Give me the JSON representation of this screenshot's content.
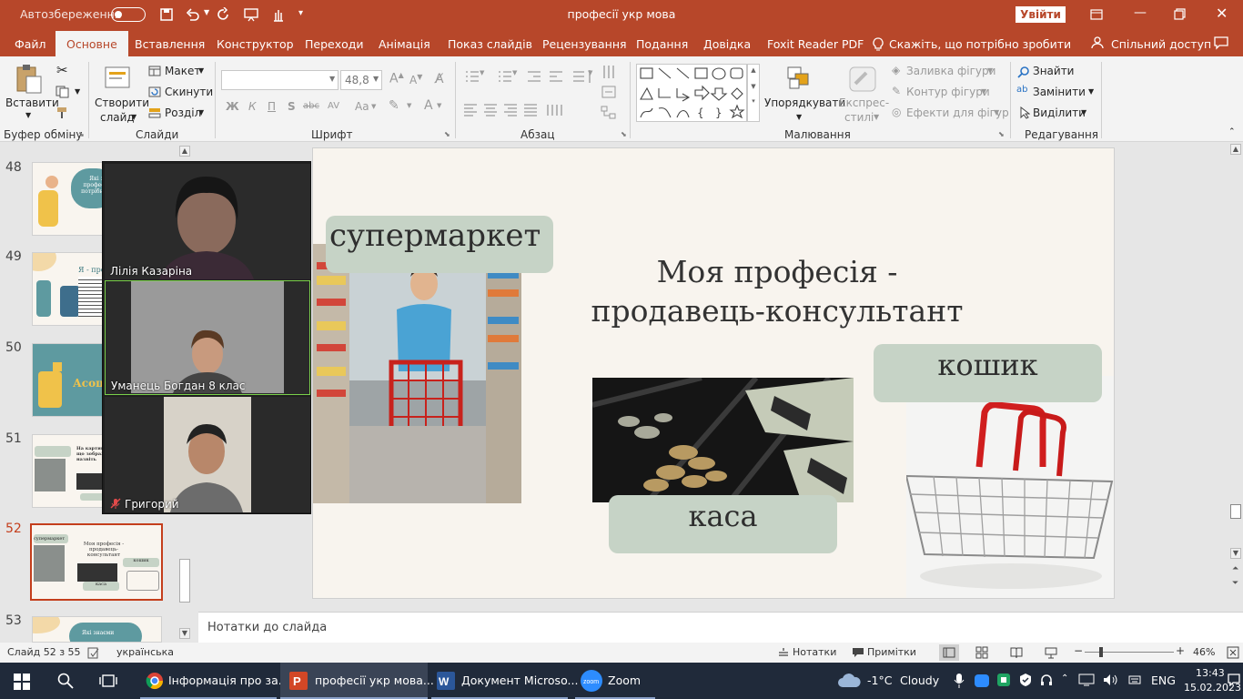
{
  "titlebar": {
    "autosave_label": "Автозбереження",
    "autosave_state": "Вимк.",
    "doc_title": "професії укр мова",
    "signin_button": "Увійти"
  },
  "tabs": [
    {
      "label": "Файл"
    },
    {
      "label": "Основне"
    },
    {
      "label": "Вставлення"
    },
    {
      "label": "Конструктор"
    },
    {
      "label": "Переходи"
    },
    {
      "label": "Анімація"
    },
    {
      "label": "Показ слайдів"
    },
    {
      "label": "Рецензування"
    },
    {
      "label": "Подання"
    },
    {
      "label": "Довідка"
    },
    {
      "label": "Foxit Reader PDF"
    },
    {
      "label": "Скажіть, що потрібно зробити"
    }
  ],
  "share_button": "Спільний доступ",
  "ribbon": {
    "clipboard": {
      "paste": "Вставити",
      "group": "Буфер обміну"
    },
    "slides": {
      "new_slide_1": "Створити",
      "new_slide_2": "слайд",
      "layout": "Макет",
      "reset": "Скинути",
      "section": "Розділ",
      "group": "Слайди"
    },
    "font": {
      "font_name": "",
      "font_size": "48,8",
      "bold": "Ж",
      "italic": "К",
      "underline": "П",
      "shadow": "S",
      "strike": "abc",
      "spacing": "AV",
      "case": "Aa",
      "group": "Шрифт"
    },
    "paragraph": {
      "group": "Абзац"
    },
    "drawing": {
      "arrange": "Упорядкувати",
      "quick_styles_1": "Експрес-",
      "quick_styles_2": "стилі",
      "fill": "Заливка фігури",
      "outline": "Контур фігури",
      "effects": "Ефекти для фігур",
      "group": "Малювання"
    },
    "editing": {
      "find": "Знайти",
      "replace": "Замінити",
      "select": "Виділити",
      "group": "Редагування"
    }
  },
  "thumbnails": [
    {
      "num": "48",
      "title": "Які з професій потрібно..."
    },
    {
      "num": "49",
      "title": "Я - професія"
    },
    {
      "num": "50",
      "title": "Асоціації"
    },
    {
      "num": "51",
      "title": "На картинках що зображено, назвіть"
    },
    {
      "num": "52",
      "title": "Моя професія - продавець-консультант"
    },
    {
      "num": "53",
      "title": "Які знаєми"
    }
  ],
  "slide": {
    "title_line1": "Моя професія -",
    "title_line2": "продавець-консультант",
    "label_supermarket": "супермаркет",
    "label_basket": "кошик",
    "label_register": "каса"
  },
  "zoom": {
    "participants": [
      {
        "name": "Лілія Казаріна"
      },
      {
        "name": "Уманець Богдан 8 клас"
      },
      {
        "name": "Григорий"
      }
    ]
  },
  "notes_placeholder": "Нотатки до слайда",
  "status": {
    "slide_counter": "Слайд 52 з 55",
    "language": "українська",
    "notes": "Нотатки",
    "comments": "Примітки",
    "zoom_level": "46%"
  },
  "taskbar": {
    "apps": [
      {
        "label": "Інформація про за..."
      },
      {
        "label": "професії укр мова..."
      },
      {
        "label": "Документ Microso..."
      },
      {
        "label": "Zoom"
      }
    ],
    "weather_temp": "-1°C",
    "weather_desc": "Cloudy",
    "lang": "ENG",
    "time": "13:43",
    "date": "15.02.2023"
  },
  "colors": {
    "accent": "#b7472a",
    "pill": "#c6d3c6",
    "slide_bg": "#f8f4ee",
    "taskbar": "#202a3a"
  }
}
